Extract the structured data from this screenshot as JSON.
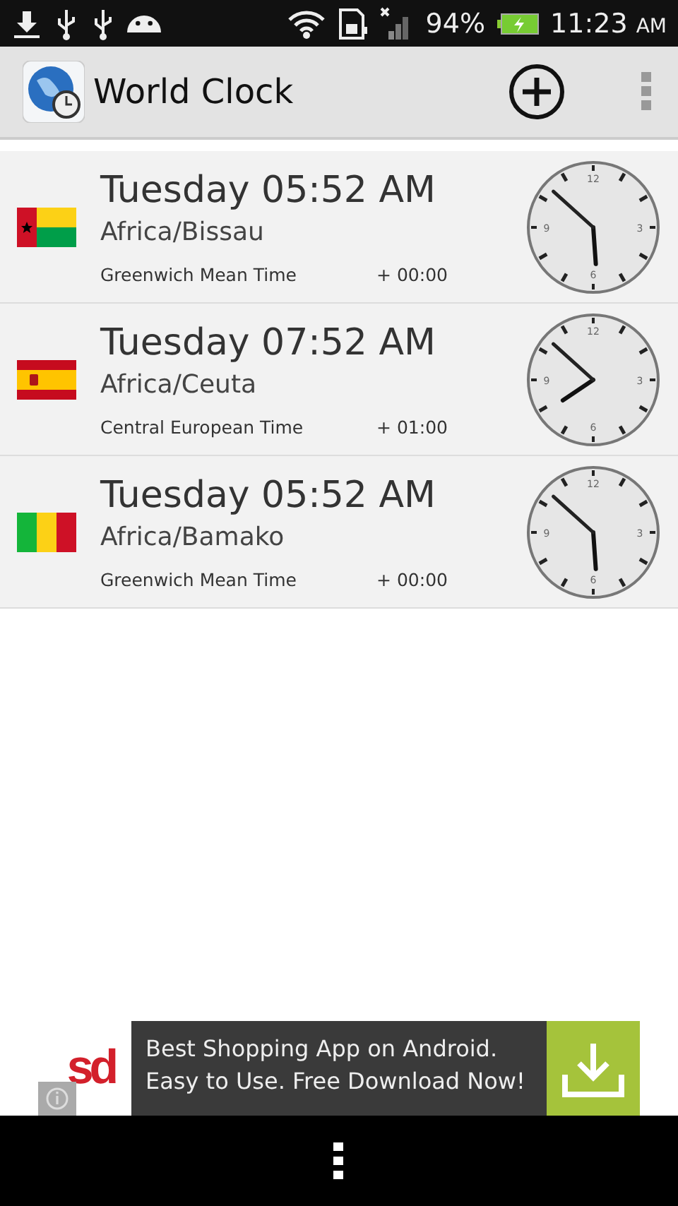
{
  "status_bar": {
    "battery": "94%",
    "time": "11:23",
    "time_suffix": "AM"
  },
  "app_bar": {
    "title": "World Clock"
  },
  "clocks": [
    {
      "kind": "guinea-bissau",
      "dial_numbers": [
        "12",
        "3",
        "6",
        "9"
      ],
      "time": "Tuesday 05:52 AM",
      "zone": "Africa/Bissau",
      "zone_name": "Greenwich Mean Time",
      "offset": "+ 00:00"
    },
    {
      "kind": "spain",
      "dial_numbers": [
        "12",
        "3",
        "6",
        "9"
      ],
      "time": "Tuesday 07:52 AM",
      "zone": "Africa/Ceuta",
      "zone_name": "Central European Time",
      "offset": "+ 01:00"
    },
    {
      "kind": "mali",
      "dial_numbers": [
        "12",
        "3",
        "6",
        "9"
      ],
      "time": "Tuesday 05:52 AM",
      "zone": "Africa/Bamako",
      "zone_name": "Greenwich Mean Time",
      "offset": "+ 00:00"
    }
  ],
  "ad": {
    "logo": "sd",
    "line_1": "Best Shopping App on Android.",
    "line_2": "Easy to Use. Free Download Now!"
  }
}
